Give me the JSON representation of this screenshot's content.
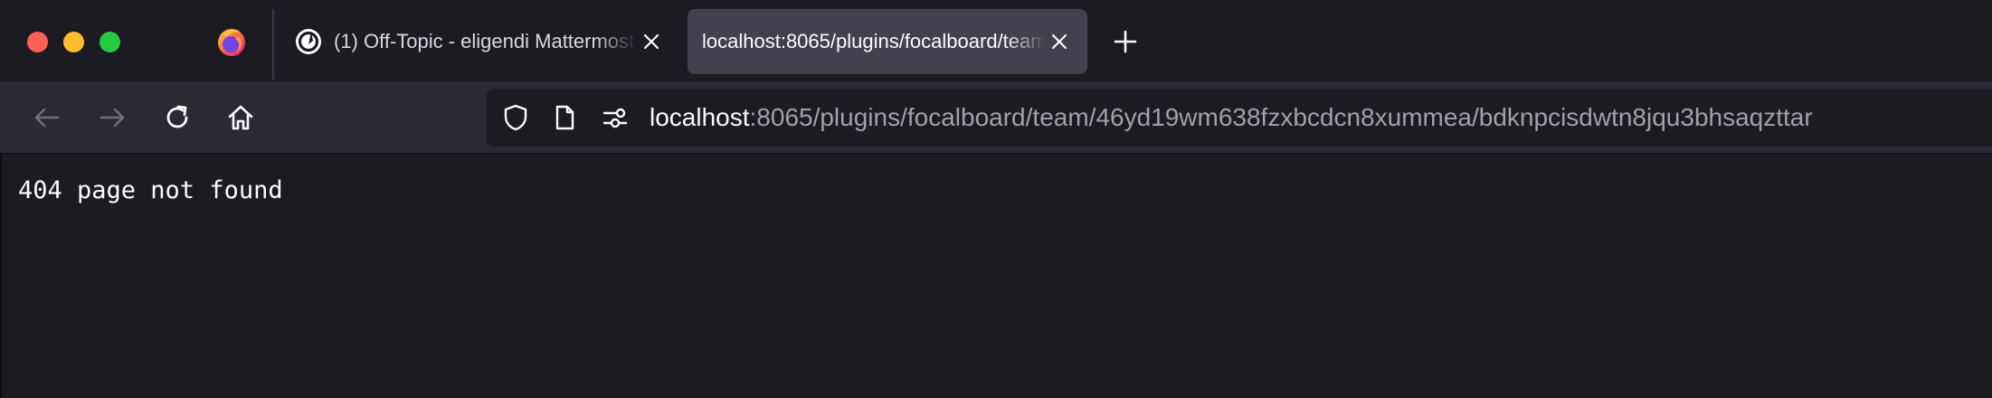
{
  "window": {
    "colors": {
      "background": "#1c1b22",
      "toolbar": "#2b2a33",
      "active_tab": "#42414d",
      "text": "#fbfbfe",
      "muted_text": "#a2a1a8",
      "close": "#fe5f57",
      "minimize": "#febc2e",
      "zoom": "#28c840"
    }
  },
  "tabs": [
    {
      "title": "(1) Off-Topic - eligendi Mattermost",
      "favicon": "mattermost-icon",
      "active": false
    },
    {
      "title": "localhost:8065/plugins/focalboard/team/46yd19wm638fzxbcdcn8xummea/bdknpcisdwtn8jqu3bhsaqzttar",
      "favicon": "",
      "active": true
    }
  ],
  "urlbar": {
    "host": "localhost",
    "rest": ":8065/plugins/focalboard/team/46yd19wm638fzxbcdcn8xummea/bdknpcisdwtn8jqu3bhsaqzttar"
  },
  "page": {
    "message": "404 page not found"
  },
  "icons": {
    "browser": "firefox-icon",
    "back": "arrow-left-icon",
    "forward": "arrow-right-icon",
    "reload": "reload-icon",
    "home": "home-icon",
    "shield": "shield-icon",
    "page": "document-icon",
    "permissions": "permissions-icon",
    "new_tab": "plus-icon",
    "close_tab": "close-icon"
  }
}
